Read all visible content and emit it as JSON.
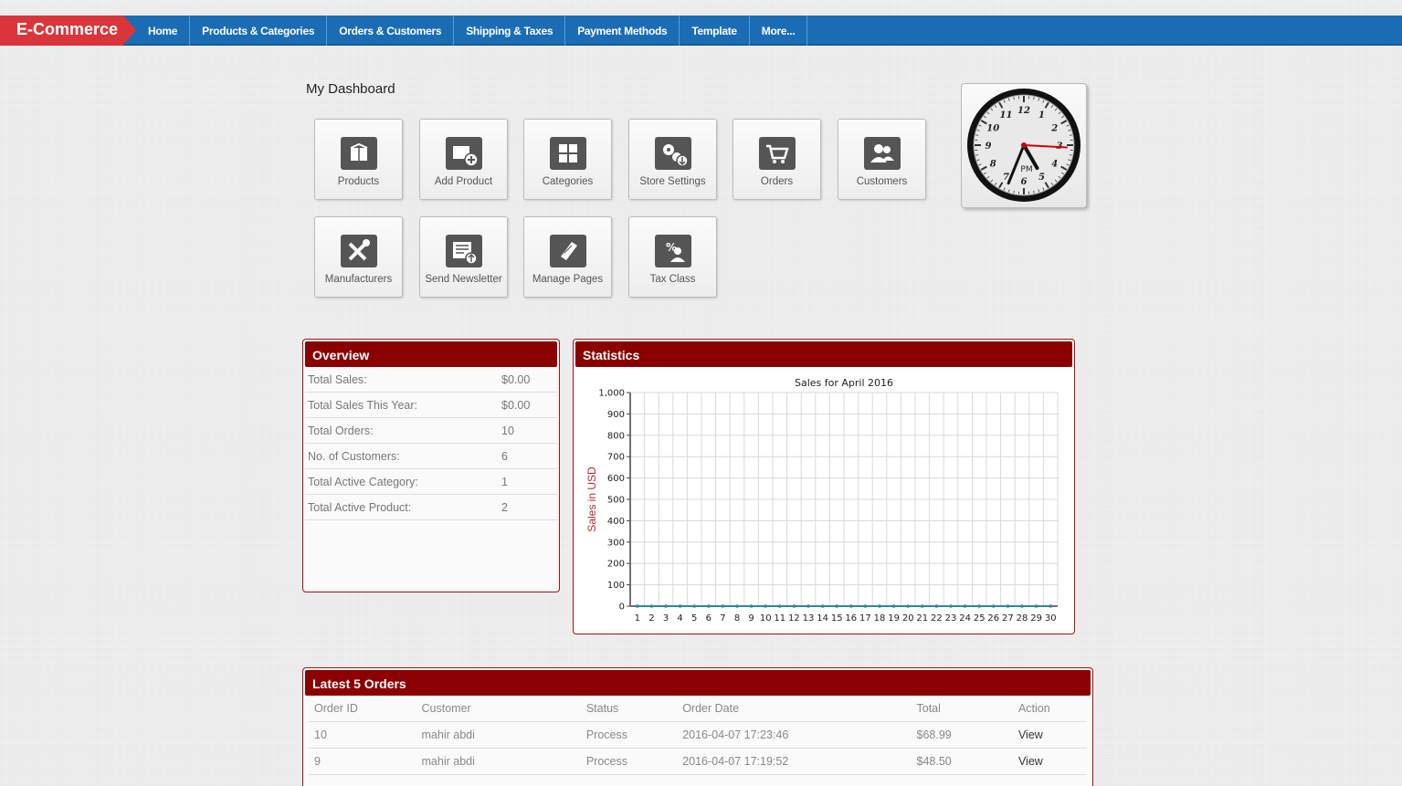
{
  "header": {
    "brand": "E-Commerce",
    "nav": [
      "Home",
      "Products & Categories",
      "Orders & Customers",
      "Shipping & Taxes",
      "Payment Methods",
      "Template",
      "More..."
    ]
  },
  "dashboard": {
    "title": "My Dashboard",
    "tiles": [
      {
        "label": "Products",
        "icon": "box-icon"
      },
      {
        "label": "Add Product",
        "icon": "add-box-icon"
      },
      {
        "label": "Categories",
        "icon": "grid-icon"
      },
      {
        "label": "Store Settings",
        "icon": "gears-icon"
      },
      {
        "label": "Orders",
        "icon": "cart-icon"
      },
      {
        "label": "Customers",
        "icon": "users-icon"
      },
      {
        "label": "Manufacturers",
        "icon": "tools-icon"
      },
      {
        "label": "Send Newsletter",
        "icon": "newsletter-icon"
      },
      {
        "label": "Manage Pages",
        "icon": "note-icon"
      },
      {
        "label": "Tax Class",
        "icon": "tax-icon"
      }
    ]
  },
  "clock": {
    "period": "PM",
    "hour_hand_deg": 150,
    "minute_hand_deg": 202,
    "second_hand_deg": 93
  },
  "overview": {
    "title": "Overview",
    "rows": [
      {
        "key": "Total Sales:",
        "value": "$0.00"
      },
      {
        "key": "Total Sales This Year:",
        "value": "$0.00"
      },
      {
        "key": "Total Orders:",
        "value": "10"
      },
      {
        "key": "No. of Customers:",
        "value": "6"
      },
      {
        "key": "Total Active Category:",
        "value": "1"
      },
      {
        "key": "Total Active Product:",
        "value": "2"
      }
    ]
  },
  "statistics": {
    "title": "Statistics"
  },
  "chart_data": {
    "type": "line",
    "title": "Sales for April 2016",
    "xlabel": "",
    "ylabel": "Sales in USD",
    "x": [
      1,
      2,
      3,
      4,
      5,
      6,
      7,
      8,
      9,
      10,
      11,
      12,
      13,
      14,
      15,
      16,
      17,
      18,
      19,
      20,
      21,
      22,
      23,
      24,
      25,
      26,
      27,
      28,
      29,
      30
    ],
    "y": [
      0,
      0,
      0,
      0,
      0,
      0,
      0,
      0,
      0,
      0,
      0,
      0,
      0,
      0,
      0,
      0,
      0,
      0,
      0,
      0,
      0,
      0,
      0,
      0,
      0,
      0,
      0,
      0,
      0,
      0
    ],
    "ylim": [
      0,
      1000
    ],
    "yticks": [
      "0",
      "100",
      "200",
      "300",
      "400",
      "500",
      "600",
      "700",
      "800",
      "900",
      "1,000"
    ],
    "grid": true,
    "line_color": "#2a8a9a"
  },
  "latest_orders": {
    "title": "Latest 5 Orders",
    "columns": [
      "Order ID",
      "Customer",
      "Status",
      "Order Date",
      "Total",
      "Action"
    ],
    "rows": [
      [
        "10",
        "mahir abdi",
        "Process",
        "2016-04-07 17:23:46",
        "$68.99",
        "View"
      ],
      [
        "9",
        "mahir abdi",
        "Process",
        "2016-04-07 17:19:52",
        "$48.50",
        "View"
      ]
    ]
  },
  "colors": {
    "nav": "#1a6db5",
    "brand": "#d9353a",
    "panel_head": "#8b0000"
  }
}
